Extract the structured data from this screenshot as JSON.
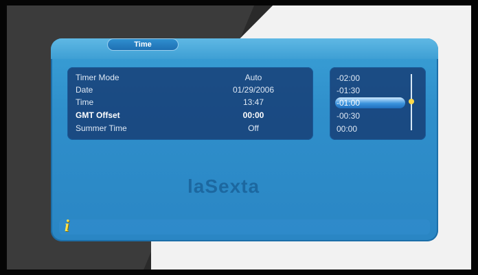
{
  "dialog": {
    "title": "Time",
    "settings": [
      {
        "label": "Timer Mode",
        "value": "Auto"
      },
      {
        "label": "Date",
        "value": "01/29/2006"
      },
      {
        "label": "Time",
        "value": "13:47"
      },
      {
        "label": "GMT Offset",
        "value": "00:00"
      },
      {
        "label": "Summer Time",
        "value": "Off"
      }
    ],
    "active_setting": "GMT Offset",
    "offset_options": [
      "-02:00",
      "-01:30",
      "-01:00",
      "-00:30",
      "00:00"
    ],
    "selected_offset": "-01:00",
    "info_icon": "i"
  },
  "background": {
    "channel_logo": "laSexta"
  },
  "colors": {
    "dialog_blue": "#2f8fcb",
    "panel_navy": "#14376e",
    "highlight_blue": "#3b93dd",
    "info_yellow": "#ffe34a"
  }
}
